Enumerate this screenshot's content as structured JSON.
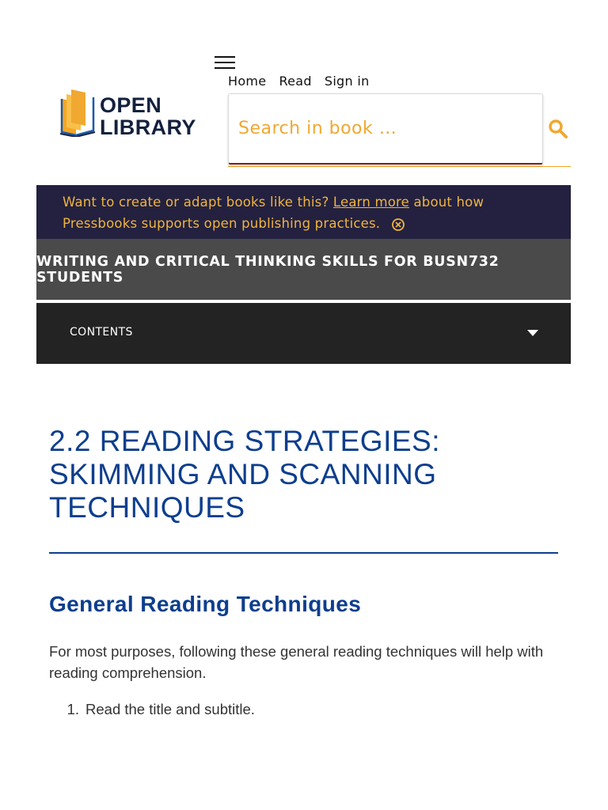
{
  "header": {
    "nav": [
      "Home",
      "Read",
      "Sign in"
    ],
    "logo": {
      "line1": "OPEN",
      "line2": "LIBRARY"
    },
    "search_placeholder": "Search in book …"
  },
  "notice": {
    "text_before": "Want to create or adapt books like this?",
    "link": "Learn more",
    "text_after": "about how Pressbooks supports open publishing practices."
  },
  "book_title": "WRITING AND CRITICAL THINKING SKILLS FOR BUSN732 STUDENTS",
  "contents_label": "CONTENTS",
  "main": {
    "chapter_title": "2.2 READING STRATEGIES: SKIMMING AND SCANNING TECHNIQUES",
    "section_heading": "General Reading Techniques",
    "paragraph": "For most purposes, following these general reading techniques will help with reading comprehension.",
    "steps": [
      {
        "number": "1.",
        "text": "Read the title and subtitle."
      }
    ]
  },
  "colors": {
    "accent": "#f0a830",
    "navy": "#0d3e8e",
    "notice_bg": "#23213f"
  }
}
